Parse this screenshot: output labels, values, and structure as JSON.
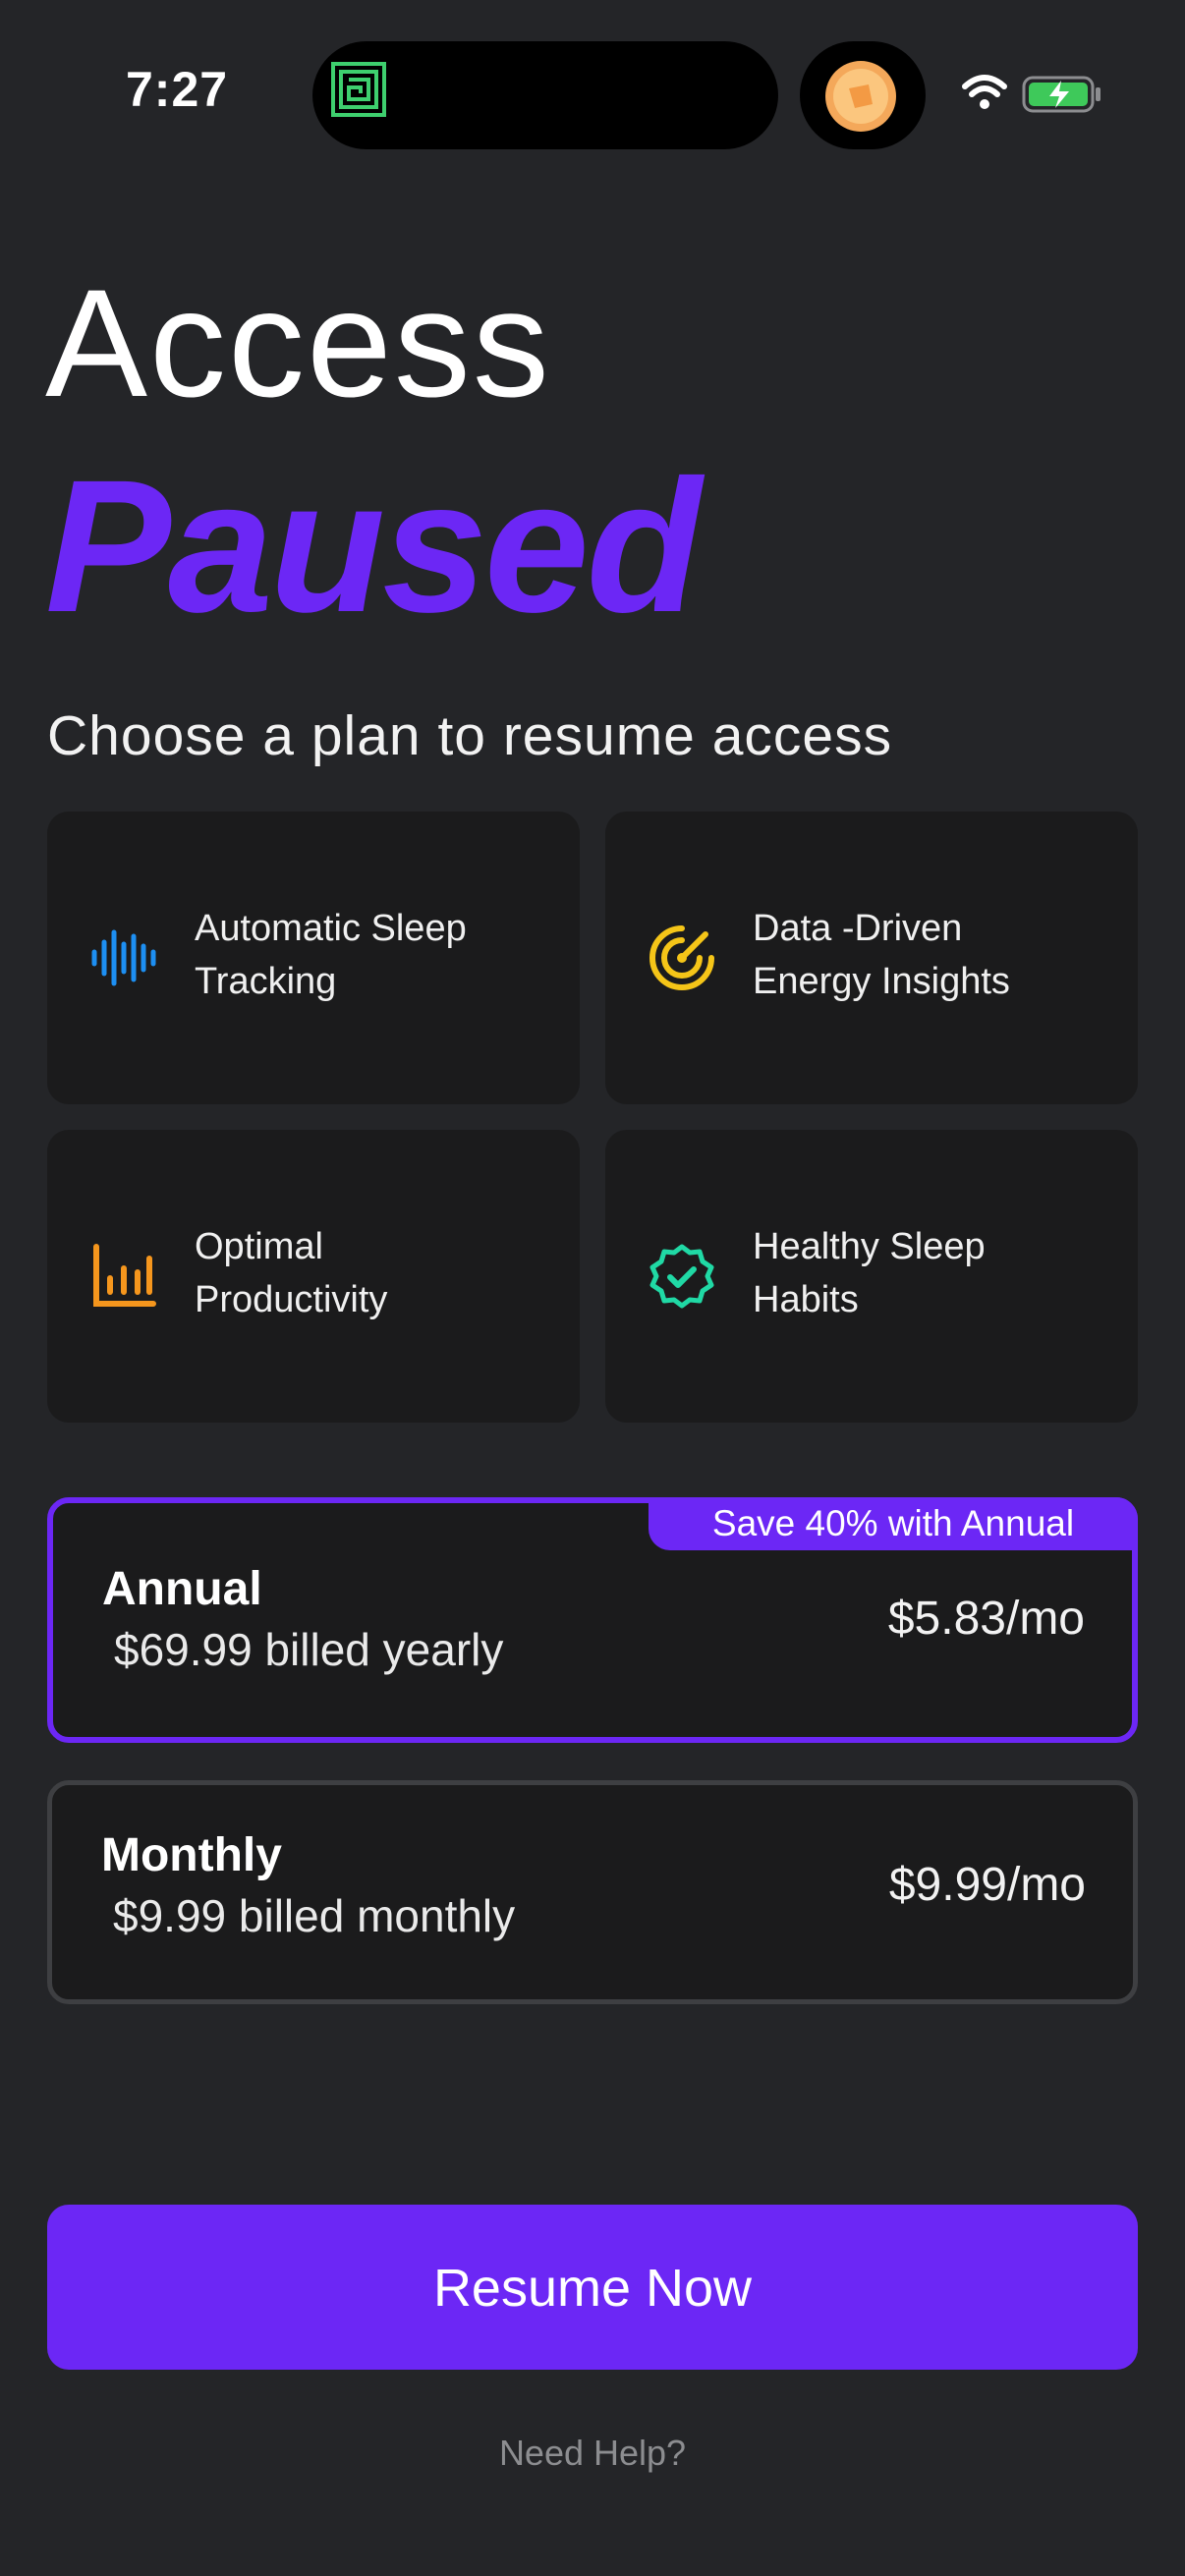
{
  "status_bar": {
    "time": "7:27"
  },
  "headline": {
    "line1": "Access",
    "line2": "Paused"
  },
  "subtitle": "Choose a plan to resume access",
  "features": [
    {
      "line1": "Automatic Sleep",
      "line2": "Tracking",
      "icon": "waveform-icon",
      "color": "#1d8ff2"
    },
    {
      "line1": "Data -Driven",
      "line2": "Energy Insights",
      "icon": "radar-icon",
      "color": "#f5c518"
    },
    {
      "line1": "Optimal",
      "line2": "Productivity",
      "icon": "bar-chart-icon",
      "color": "#f5961d"
    },
    {
      "line1": "Healthy Sleep",
      "line2": "Habits",
      "icon": "verified-badge-icon",
      "color": "#20d9a5"
    }
  ],
  "plans": {
    "annual": {
      "name": "Annual",
      "billing": "$69.99 billed yearly",
      "price": "$5.83/mo",
      "badge": "Save 40% with Annual",
      "selected": true
    },
    "monthly": {
      "name": "Monthly",
      "billing": "$9.99 billed monthly",
      "price": "$9.99/mo",
      "selected": false
    }
  },
  "cta_label": "Resume Now",
  "help_link": "Need Help?",
  "colors": {
    "background": "#242528",
    "accent": "#6c27f5",
    "card": "#1b1b1c"
  }
}
